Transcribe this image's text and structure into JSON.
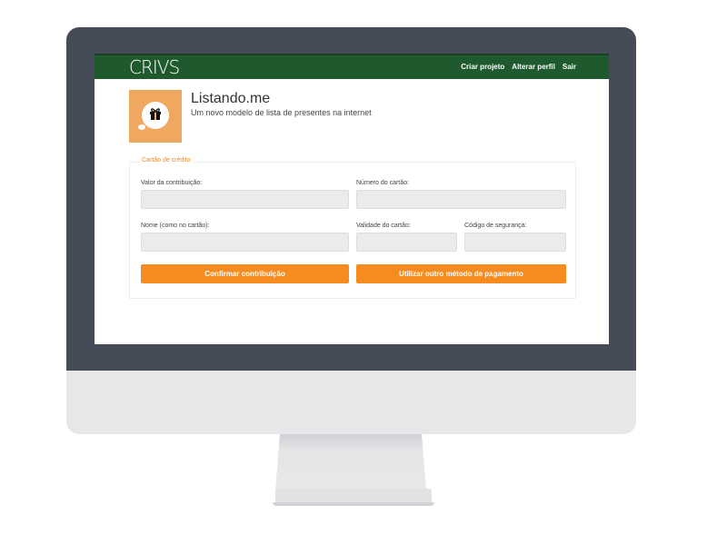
{
  "app": {
    "logo": "CRIVS"
  },
  "nav": {
    "items": [
      {
        "label": "Criar projeto"
      },
      {
        "label": "Alterar perfil"
      },
      {
        "label": "Sair"
      }
    ]
  },
  "project": {
    "title": "Listando.me",
    "subtitle": "Um novo modelo de lista de presentes na internet",
    "icon": "gift-icon"
  },
  "form": {
    "legend": "Cartão de crédito",
    "fields": {
      "amount": {
        "label": "Valor da contribuição:",
        "value": "",
        "placeholder": ""
      },
      "card_number": {
        "label": "Número do cartão:",
        "value": "",
        "placeholder": ""
      },
      "name": {
        "label": "Nome (como no cartão):",
        "value": "",
        "placeholder": ""
      },
      "expiry": {
        "label": "Validade do cartão:",
        "value": "",
        "placeholder": ""
      },
      "cvv": {
        "label": "Código de segurança:",
        "value": "",
        "placeholder": ""
      }
    },
    "buttons": {
      "confirm": "Confirmar contribuição",
      "other_method": "Utilizar outro método de pagamento"
    }
  },
  "colors": {
    "topbar": "#1f5a2e",
    "accent": "#f68b1f",
    "thumb": "#f0a760",
    "bezel": "#464c57"
  }
}
